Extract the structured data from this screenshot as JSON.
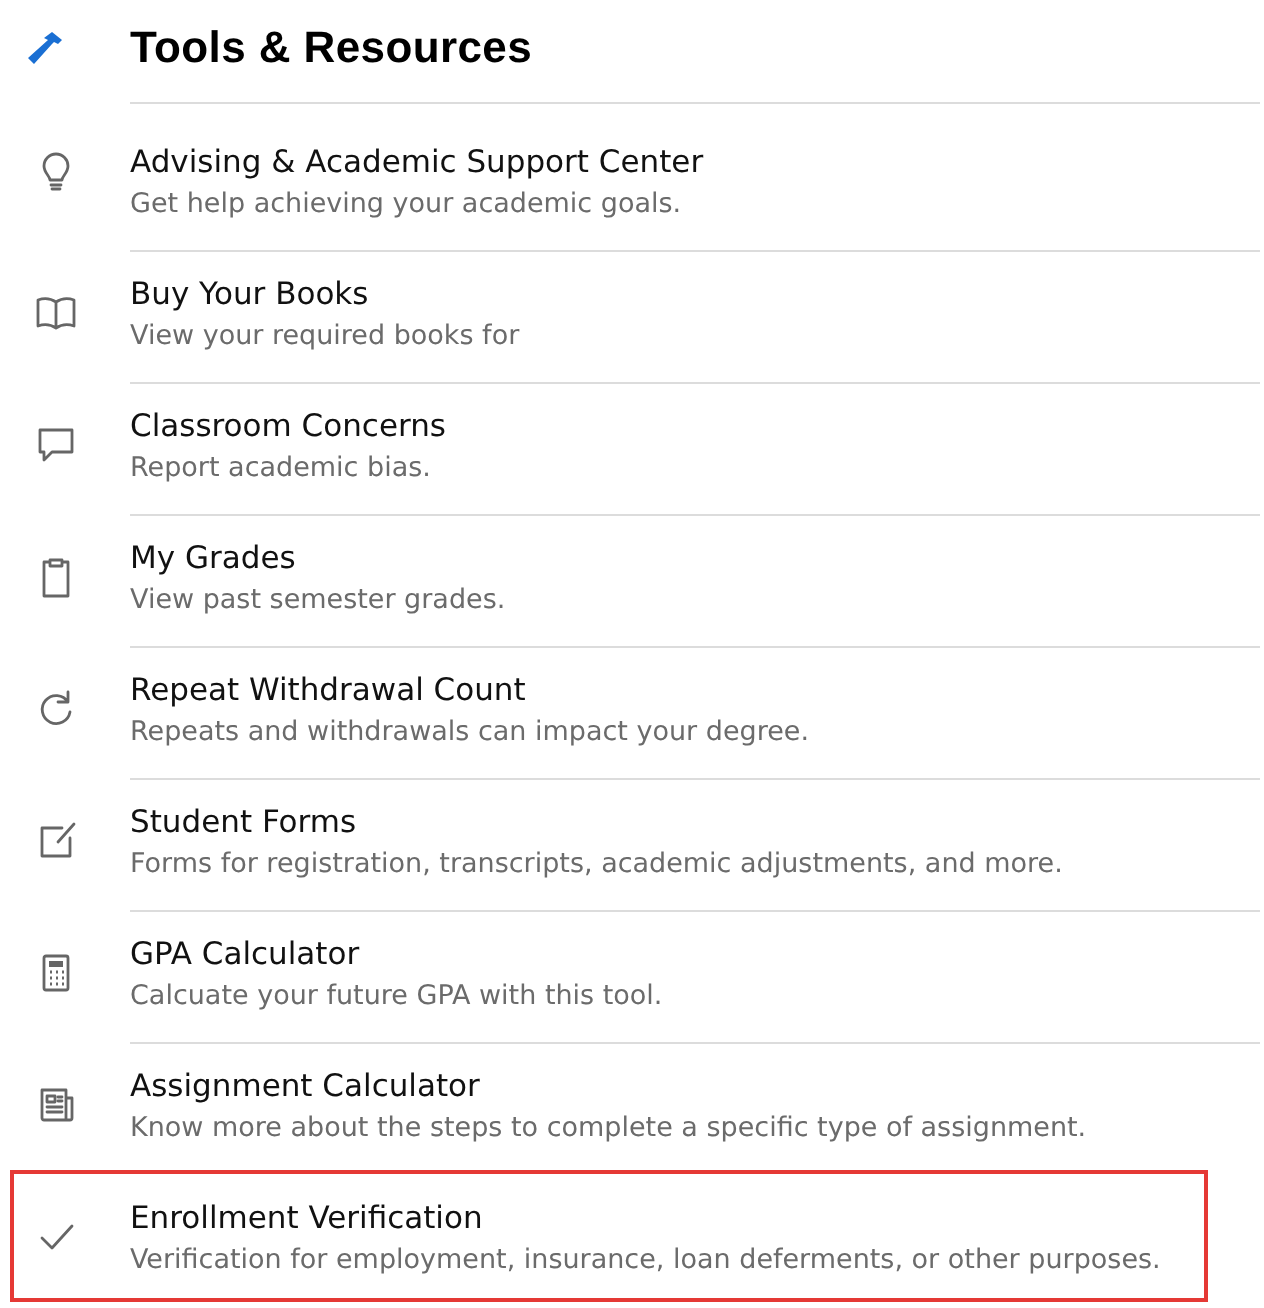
{
  "header": {
    "title": "Tools & Resources"
  },
  "items": [
    {
      "title": "Advising & Academic Support Center",
      "subtitle": "Get help achieving your academic goals.",
      "highlighted": false
    },
    {
      "title": "Buy Your Books",
      "subtitle": "View your required books for",
      "highlighted": false
    },
    {
      "title": "Classroom Concerns",
      "subtitle": "Report academic bias.",
      "highlighted": false
    },
    {
      "title": "My Grades",
      "subtitle": "View past semester grades.",
      "highlighted": false
    },
    {
      "title": "Repeat Withdrawal Count",
      "subtitle": "Repeats and withdrawals can impact your degree.",
      "highlighted": false
    },
    {
      "title": "Student Forms",
      "subtitle": "Forms for registration, transcripts, academic adjustments, and more.",
      "highlighted": false
    },
    {
      "title": "GPA Calculator",
      "subtitle": "Calcuate your future GPA with this tool.",
      "highlighted": false
    },
    {
      "title": "Assignment Calculator",
      "subtitle": "Know more about the steps to complete a specific type of assignment.",
      "highlighted": false
    },
    {
      "title": "Enrollment Verification",
      "subtitle": "Verification for employment, insurance, loan deferments, or other purposes.",
      "highlighted": true
    }
  ]
}
